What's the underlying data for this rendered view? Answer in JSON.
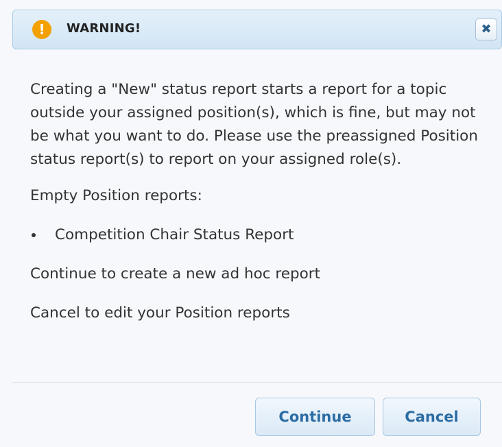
{
  "dialog": {
    "title": "WARNING!",
    "title_icon": "exclamation-circle-icon",
    "icon_glyph": "!",
    "close_icon": "close-icon",
    "close_glyph": "✖",
    "colors": {
      "titlebar_bg": "#d9eaf7",
      "titlebar_border": "#a9cbe8",
      "warning_icon": "#f2a100",
      "button_text": "#2b6ca3",
      "body_text": "#333333"
    }
  },
  "body": {
    "intro": "Creating a \"New\" status report starts a report for a topic outside your assigned position(s), which is fine, but may not be what you want to do. Please use the preassigned Position status report(s) to report on your assigned role(s).",
    "empty_reports_label": "Empty Position reports:",
    "empty_reports": [
      "Competition Chair Status Report"
    ],
    "continue_hint": "Continue to create a new ad hoc report",
    "cancel_hint": "Cancel to edit your Position reports"
  },
  "buttons": {
    "continue": "Continue",
    "cancel": "Cancel"
  }
}
